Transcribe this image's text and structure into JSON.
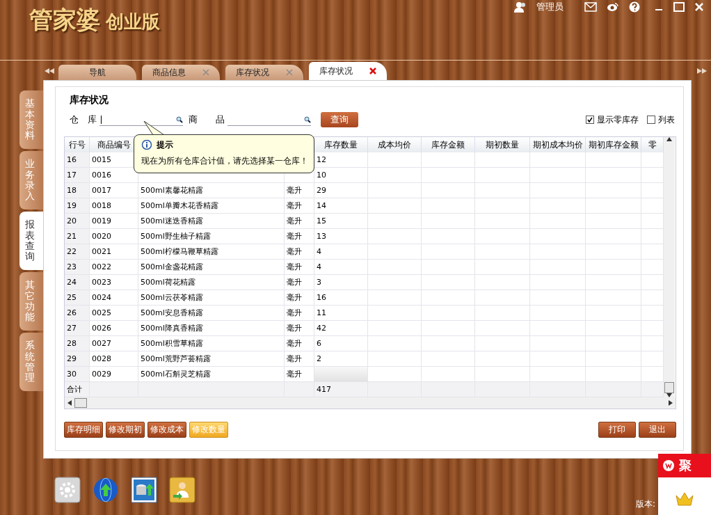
{
  "app": {
    "logo": "管家婆",
    "edition": "创业版",
    "user": "管理员"
  },
  "tabs": [
    {
      "label": "导航",
      "selected": false,
      "closable": false
    },
    {
      "label": "商品信息",
      "selected": false,
      "closable": true
    },
    {
      "label": "库存状况",
      "selected": false,
      "closable": true
    },
    {
      "label": "库存状况",
      "selected": true,
      "closable": true
    }
  ],
  "side_tabs": [
    {
      "label": "基本资料",
      "selected": false
    },
    {
      "label": "业务录入",
      "selected": false
    },
    {
      "label": "报表查询",
      "selected": true
    },
    {
      "label": "其它功能",
      "selected": false
    },
    {
      "label": "系统管理",
      "selected": false
    }
  ],
  "page_title": "库存状况",
  "filters": {
    "warehouse_label": "仓　库",
    "product_label": "商　　品",
    "query_button": "查询",
    "options": [
      {
        "label": "显示零库存",
        "checked": true
      },
      {
        "label": "列表",
        "checked": false
      }
    ]
  },
  "tooltip": {
    "title": "提示",
    "message": "现在为所有仓库合计值，请先选择某一仓库！"
  },
  "table": {
    "columns": [
      "行号",
      "商品编号",
      "库存数量",
      "成本均价",
      "库存金额",
      "期初数量",
      "期初成本均价",
      "期初库存金额",
      "零"
    ],
    "rows": [
      {
        "no": "16",
        "code": "0015",
        "qty": "12"
      },
      {
        "no": "17",
        "code": "0016",
        "qty": "10"
      },
      {
        "no": "18",
        "code": "0017",
        "name": "500ml素馨花精露",
        "unit": "毫升",
        "qty": "29"
      },
      {
        "no": "19",
        "code": "0018",
        "name": "500ml单瓣木花香精露",
        "unit": "毫升",
        "qty": "14"
      },
      {
        "no": "20",
        "code": "0019",
        "name": "500ml迷迭香精露",
        "unit": "毫升",
        "qty": "15"
      },
      {
        "no": "21",
        "code": "0020",
        "name": "500ml野生柚子精露",
        "unit": "毫升",
        "qty": "13"
      },
      {
        "no": "22",
        "code": "0021",
        "name": "500ml柠檬马鞭草精露",
        "unit": "毫升",
        "qty": "4"
      },
      {
        "no": "23",
        "code": "0022",
        "name": "500ml金盏花精露",
        "unit": "毫升",
        "qty": "4"
      },
      {
        "no": "24",
        "code": "0023",
        "name": "500ml荷花精露",
        "unit": "毫升",
        "qty": "3"
      },
      {
        "no": "25",
        "code": "0024",
        "name": "500ml云茯苓精露",
        "unit": "毫升",
        "qty": "16"
      },
      {
        "no": "26",
        "code": "0025",
        "name": "500ml安息香精露",
        "unit": "毫升",
        "qty": "11"
      },
      {
        "no": "27",
        "code": "0026",
        "name": "500ml降真香精露",
        "unit": "毫升",
        "qty": "42"
      },
      {
        "no": "28",
        "code": "0027",
        "name": "500ml积雪草精露",
        "unit": "毫升",
        "qty": "6"
      },
      {
        "no": "29",
        "code": "0028",
        "name": "500ml荒野芦荟精露",
        "unit": "毫升",
        "qty": "2"
      },
      {
        "no": "30",
        "code": "0029",
        "name": "500ml石斛灵芝精露",
        "unit": "毫升",
        "qty_selected": true
      }
    ],
    "total": {
      "label": "合计",
      "qty": "417"
    }
  },
  "actions": [
    {
      "label": "库存明细",
      "highlighted": false
    },
    {
      "label": "修改期初",
      "highlighted": false
    },
    {
      "label": "修改成本",
      "highlighted": false
    },
    {
      "label": "修改数量",
      "highlighted": true
    }
  ],
  "right_actions": [
    "打印",
    "退出"
  ],
  "footer": {
    "version_label": "版本:"
  },
  "ad": {
    "title": "聚"
  }
}
